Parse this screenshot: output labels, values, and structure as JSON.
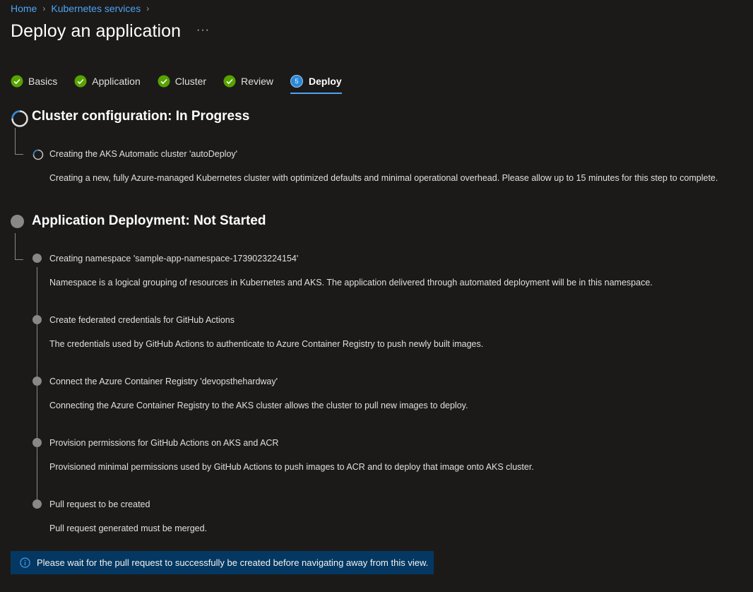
{
  "breadcrumb": [
    "Home",
    "Kubernetes services"
  ],
  "page_title": "Deploy an application",
  "more_label": "···",
  "tabs": [
    {
      "label": "Basics",
      "state": "complete"
    },
    {
      "label": "Application",
      "state": "complete"
    },
    {
      "label": "Cluster",
      "state": "complete"
    },
    {
      "label": "Review",
      "state": "complete"
    },
    {
      "label": "Deploy",
      "state": "active",
      "number": "5"
    }
  ],
  "cluster_section": {
    "title": "Cluster configuration: In Progress",
    "steps": [
      {
        "title": "Creating the AKS Automatic cluster 'autoDeploy'",
        "description": "Creating a new, fully Azure-managed Kubernetes cluster with optimized defaults and minimal operational overhead. Please allow up to 15 minutes for this step to complete."
      }
    ]
  },
  "app_section": {
    "title": "Application Deployment: Not Started",
    "steps": [
      {
        "title": "Creating namespace 'sample-app-namespace-1739023224154'",
        "description": "Namespace is a logical grouping of resources in Kubernetes and AKS. The application delivered through automated deployment will be in this namespace."
      },
      {
        "title": "Create federated credentials for GitHub Actions",
        "description": "The credentials used by GitHub Actions to authenticate to Azure Container Registry to push newly built images."
      },
      {
        "title": "Connect the Azure Container Registry 'devopsthehardway'",
        "description": "Connecting the Azure Container Registry to the AKS cluster allows the cluster to pull new images to deploy."
      },
      {
        "title": "Provision permissions for GitHub Actions on AKS and ACR",
        "description": "Provisioned minimal permissions used by GitHub Actions to push images to ACR and to deploy that image onto AKS cluster."
      },
      {
        "title": "Pull request to be created",
        "description": "Pull request generated must be merged."
      }
    ]
  },
  "info_banner": "Please wait for the pull request to successfully be created before navigating away from this view.",
  "colors": {
    "accent": "#4ea3f1",
    "success": "#57a300",
    "pending": "#8a8886",
    "banner": "#043862"
  }
}
